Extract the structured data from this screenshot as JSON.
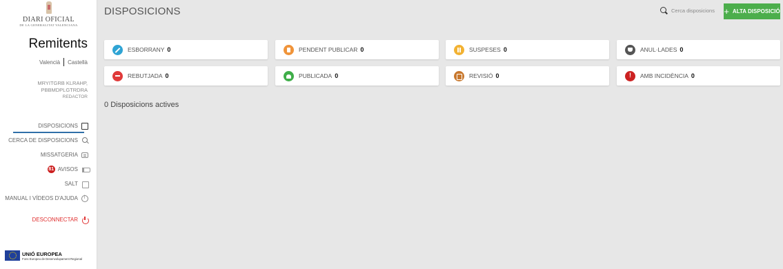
{
  "logo": {
    "title": "DIARI OFICIAL",
    "subtitle": "DE LA GENERALITAT VALENCIANA"
  },
  "sidebar": {
    "heading": "Remitents",
    "languages": [
      "Valencià",
      "Castellà"
    ],
    "user": {
      "name_line1": "MRYITGRB KLRAHP,",
      "name_line2": "PBBMDPLGTRDRA",
      "role": "REDACTOR"
    },
    "nav": [
      {
        "label": "DISPOSICIONS",
        "icon": "document-icon",
        "active": true
      },
      {
        "label": "CERCA DE DISPOSICIONS",
        "icon": "search-icon"
      },
      {
        "label": "MISSATGERIA",
        "icon": "message-icon"
      },
      {
        "label": "AVISOS",
        "icon": "megaphone-icon",
        "badge": "81"
      },
      {
        "label": "SALT",
        "icon": "salt-icon"
      },
      {
        "label": "MANUAL I VÍDEOS D'AJUDA",
        "icon": "help-icon"
      }
    ],
    "logout": {
      "label": "DESCONNECTAR",
      "icon": "power-icon"
    },
    "eu": {
      "title": "UNIÓ EUROPEA",
      "subtitle": "Fons Europeu de Desenvolupament Regional"
    }
  },
  "header": {
    "title": "DISPOSICIONS",
    "search_placeholder": "Cerca disposicions",
    "new_button": "ALTA DISPOSICIÓ"
  },
  "status_cards": [
    {
      "label": "ESBORRANY",
      "count": "0",
      "color": "#2fa4d4",
      "icon": "pencil-icon"
    },
    {
      "label": "PENDENT PUBLICAR",
      "count": "0",
      "color": "#f0943a",
      "icon": "file-icon"
    },
    {
      "label": "SUSPESES",
      "count": "0",
      "color": "#f2b233",
      "icon": "pause-icon"
    },
    {
      "label": "ANUL·LADES",
      "count": "0",
      "color": "#555555",
      "icon": "thumbs-down-icon"
    },
    {
      "label": "REBUTJADA",
      "count": "0",
      "color": "#e03a3a",
      "icon": "minus-icon"
    },
    {
      "label": "PUBLICADA",
      "count": "0",
      "color": "#3fae49",
      "icon": "thumbs-up-icon"
    },
    {
      "label": "REVISIÓ",
      "count": "0",
      "color": "#c8782e",
      "icon": "review-icon"
    },
    {
      "label": "AMB INCIDÈNCIA",
      "count": "0",
      "color": "#cc2222",
      "icon": "warning-icon"
    }
  ],
  "active_count": {
    "count": "0",
    "label": "Disposicions actives"
  },
  "colors": {
    "accent_green": "#4cae4c",
    "nav_active": "#2f6fa8",
    "logout_red": "#e03030"
  }
}
